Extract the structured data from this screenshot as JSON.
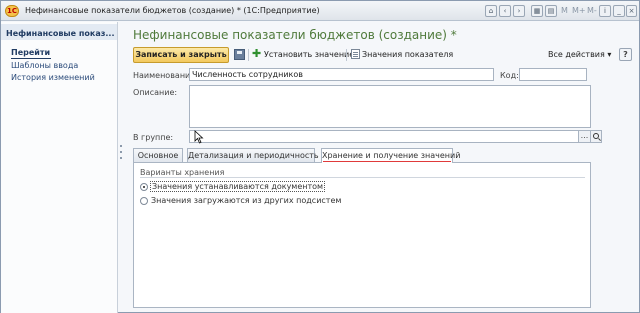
{
  "window": {
    "app_logo": "1С",
    "title": "Нефинансовые показатели бюджетов (создание) * (1С:Предприятие)",
    "toolbar_letters": [
      "M",
      "M+",
      "M-"
    ],
    "icons": [
      "home-icon",
      "back-icon",
      "forward-icon",
      "calculator-icon",
      "calendar-icon",
      "favorites-icon",
      "minimize-icon",
      "maximize-icon",
      "close-icon"
    ]
  },
  "nav": {
    "header": "Нефинансовые показ...",
    "go_label": "Перейти",
    "links": [
      "Шаблоны ввода",
      "История изменений"
    ]
  },
  "form": {
    "title": "Нефинансовые показатели бюджетов (создание) *",
    "toolbar": {
      "save_close": "Записать и закрыть",
      "set_value": "Установить значение",
      "indicator_values": "Значения показателя",
      "all_actions": "Все действия ▾",
      "help": "?"
    },
    "fields": {
      "name_label": "Наименование:",
      "name_value": "Численность сотрудников",
      "code_label": "Код:",
      "code_value": "",
      "description_label": "Описание:",
      "description_value": "",
      "group_label": "В группе:",
      "group_value": "",
      "group_select": "..."
    },
    "tabs": [
      {
        "label": "Основное",
        "active": false
      },
      {
        "label": "Детализация и периодичность",
        "active": false
      },
      {
        "label": "Хранение и получение значений",
        "active": true
      }
    ],
    "storage_panel": {
      "group_title": "Варианты хранения",
      "options": [
        {
          "label": "Значения устанавливаются документом",
          "selected": true
        },
        {
          "label": "Значения загружаются из других подсистем",
          "selected": false
        }
      ]
    }
  },
  "colors": {
    "title_green": "#4f7a3b",
    "accent_button": "#f3c95e",
    "tab_highlight": "#e03a3a"
  }
}
